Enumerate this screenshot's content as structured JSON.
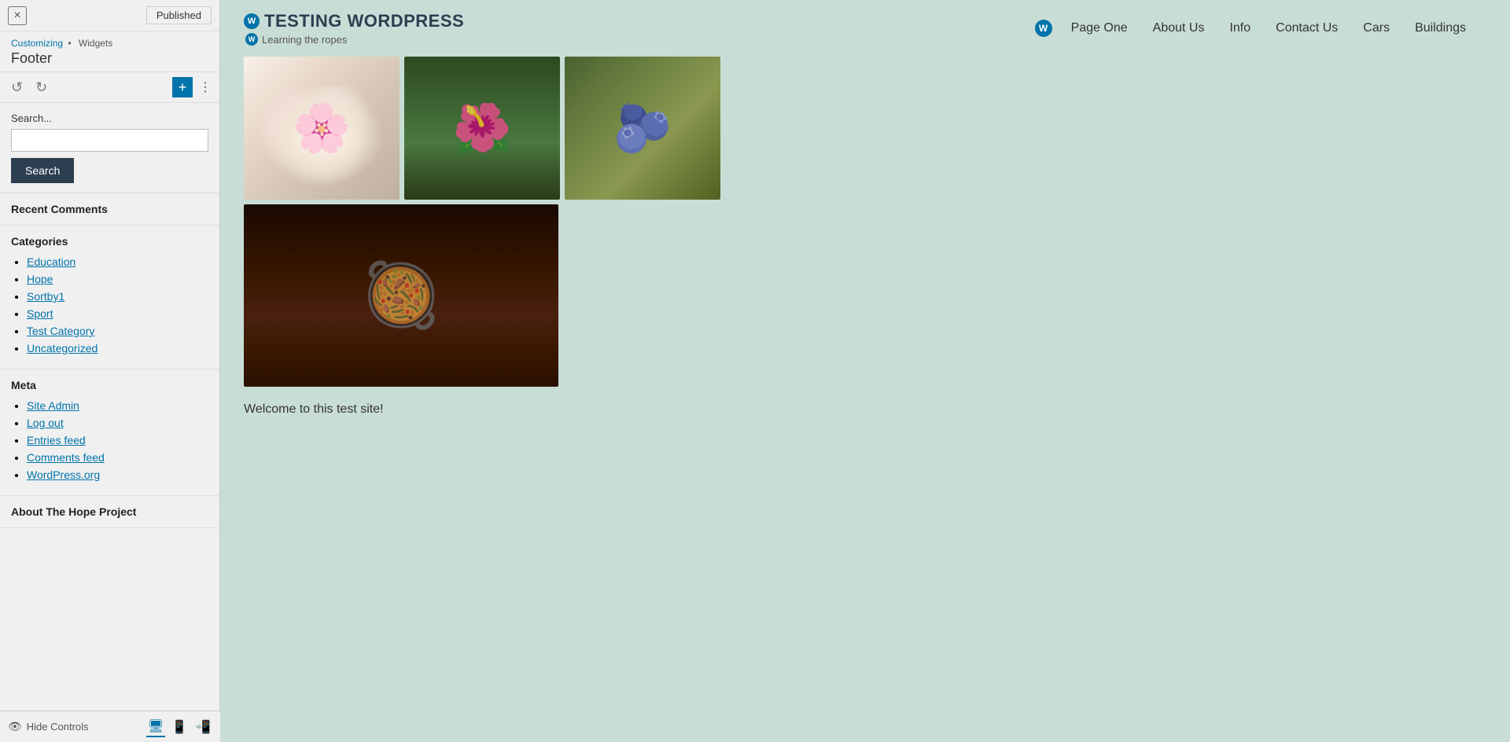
{
  "leftPanel": {
    "closeBtn": "×",
    "publishedBtn": "Published",
    "breadcrumb": {
      "parent": "Customizing",
      "separator": "•",
      "current": "Widgets"
    },
    "title": "Footer",
    "toolbar": {
      "undoBtn": "↺",
      "redoBtn": "↻",
      "addBtn": "+",
      "moreBtn": "⋮"
    },
    "searchWidget": {
      "label": "Search...",
      "placeholder": "",
      "buttonLabel": "Search"
    },
    "recentCommentsWidget": {
      "title": "Recent Comments"
    },
    "categoriesWidget": {
      "title": "Categories",
      "items": [
        {
          "label": "Education",
          "href": "#"
        },
        {
          "label": "Hope",
          "href": "#"
        },
        {
          "label": "Sortby1",
          "href": "#"
        },
        {
          "label": "Sport",
          "href": "#"
        },
        {
          "label": "Test Category",
          "href": "#"
        },
        {
          "label": "Uncategorized",
          "href": "#"
        }
      ]
    },
    "metaWidget": {
      "title": "Meta",
      "items": [
        {
          "label": "Site Admin",
          "href": "#"
        },
        {
          "label": "Log out",
          "href": "#"
        },
        {
          "label": "Entries feed",
          "href": "#"
        },
        {
          "label": "Comments feed",
          "href": "#"
        },
        {
          "label": "WordPress.org",
          "href": "#"
        }
      ]
    },
    "aboutWidget": {
      "title": "About The Hope Project"
    },
    "bottomBar": {
      "hideControlsLabel": "Hide Controls",
      "viewBtns": [
        "desktop",
        "tablet",
        "mobile"
      ]
    }
  },
  "site": {
    "title": "TESTING WORDPRESS",
    "tagline": "Learning the ropes",
    "nav": [
      {
        "label": "Page One"
      },
      {
        "label": "About Us"
      },
      {
        "label": "Info"
      },
      {
        "label": "Contact Us"
      },
      {
        "label": "Cars"
      },
      {
        "label": "Buildings"
      }
    ],
    "welcomeText": "Welcome to this test site!"
  },
  "gallery": {
    "images": [
      {
        "alt": "White cherry blossoms"
      },
      {
        "alt": "Red flower with green background"
      },
      {
        "alt": "Market berries and grapes"
      },
      {
        "alt": "Cooking pot with vegetables"
      }
    ]
  }
}
